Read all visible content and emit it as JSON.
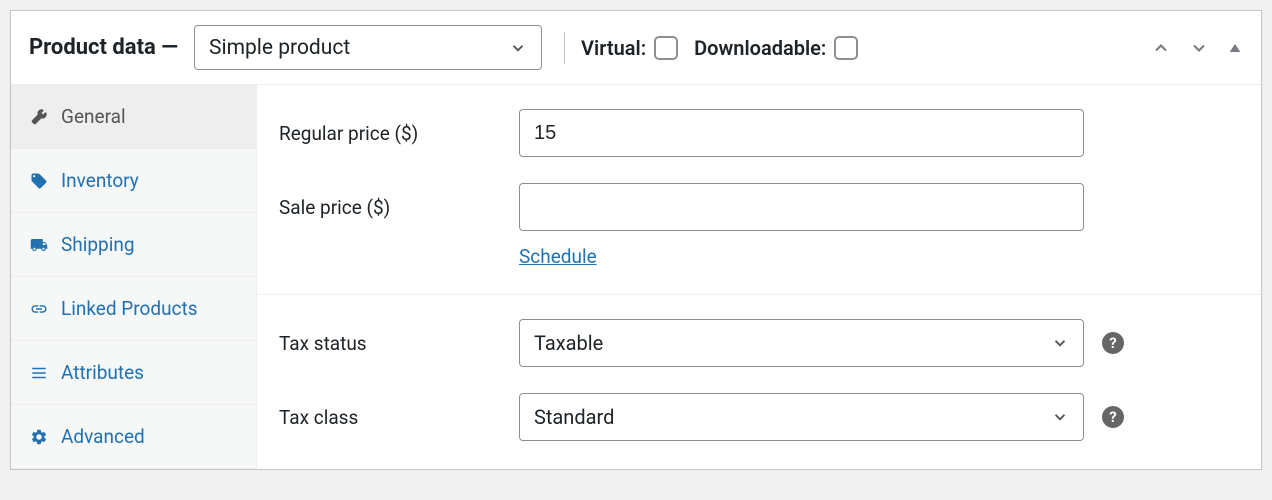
{
  "header": {
    "title": "Product data —",
    "product_type": "Simple product",
    "virtual_label": "Virtual:",
    "downloadable_label": "Downloadable:"
  },
  "tabs": [
    {
      "key": "general",
      "label": "General",
      "active": true
    },
    {
      "key": "inventory",
      "label": "Inventory",
      "active": false
    },
    {
      "key": "shipping",
      "label": "Shipping",
      "active": false
    },
    {
      "key": "linked",
      "label": "Linked Products",
      "active": false
    },
    {
      "key": "attributes",
      "label": "Attributes",
      "active": false
    },
    {
      "key": "advanced",
      "label": "Advanced",
      "active": false
    }
  ],
  "fields": {
    "regular_price_label": "Regular price ($)",
    "regular_price_value": "15",
    "sale_price_label": "Sale price ($)",
    "sale_price_value": "",
    "schedule_label": "Schedule",
    "tax_status_label": "Tax status",
    "tax_status_value": "Taxable",
    "tax_class_label": "Tax class",
    "tax_class_value": "Standard"
  }
}
